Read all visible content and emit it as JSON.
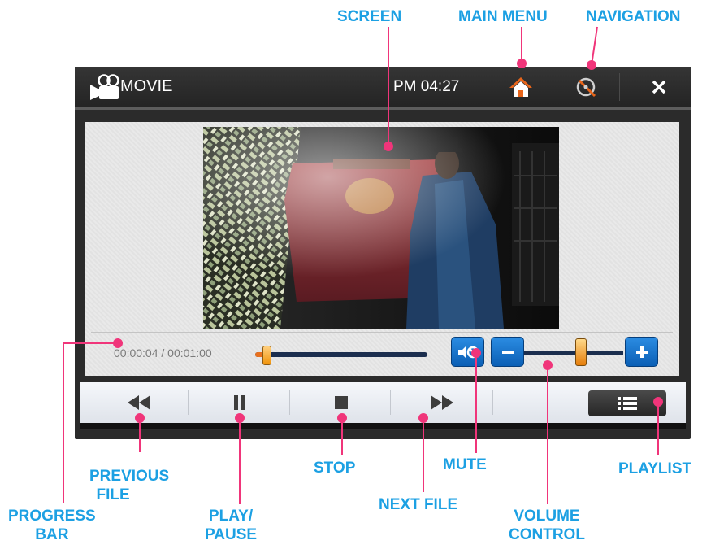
{
  "callouts": {
    "screen": "SCREEN",
    "main_menu": "MAIN MENU",
    "navigation": "NAVIGATION",
    "previous_file": [
      "PREVIOUS",
      "FILE"
    ],
    "play_pause": [
      "PLAY/",
      "PAUSE"
    ],
    "stop": "STOP",
    "mute": "MUTE",
    "next_file": "NEXT FILE",
    "playlist": "PLAYLIST",
    "progress_bar": [
      "PROGRESS",
      "BAR"
    ],
    "volume_control": [
      "VOLUME",
      "CONTROL"
    ]
  },
  "topbar": {
    "title": "MOVIE",
    "clock": "PM 04:27",
    "icons": [
      "movie-camera-icon",
      "home-icon",
      "navigation-compass-icon",
      "close-icon"
    ]
  },
  "player": {
    "elapsed_total": "00:00:04 / 00:01:00",
    "progress_fraction": 0.067,
    "volume_fraction": 0.55
  },
  "controls": {
    "icons": [
      "rewind-icon",
      "pause-icon",
      "stop-icon",
      "fast-forward-icon",
      "playlist-icon"
    ]
  },
  "colors": {
    "callout": "#1ca0e3",
    "leader_dot": "#f0357a",
    "blue_button": "#1678d0",
    "handle_orange": "#f0930a"
  }
}
